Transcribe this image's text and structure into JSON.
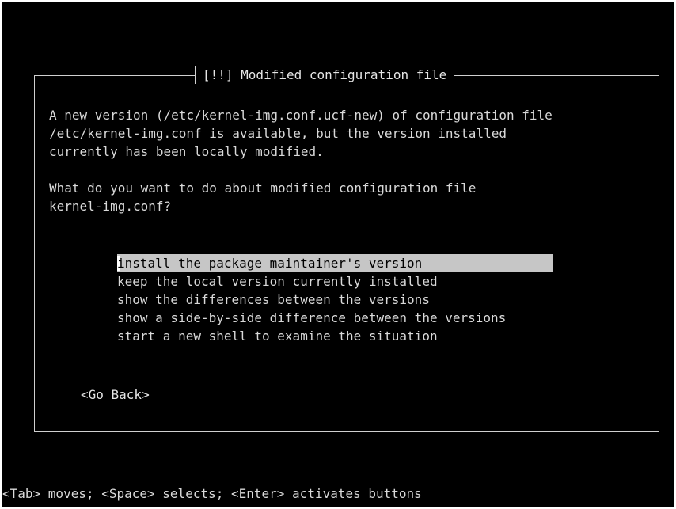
{
  "dialog": {
    "title": "[!!] Modified configuration file",
    "message_lines": [
      "A new version (/etc/kernel-img.conf.ucf-new) of configuration file",
      "/etc/kernel-img.conf is available, but the version installed",
      "currently has been locally modified."
    ],
    "question_lines": [
      "What do you want to do about modified configuration file",
      "kernel-img.conf?"
    ],
    "options": [
      "install the package maintainer's version",
      "keep the local version currently installed",
      "show the differences between the versions",
      "show a side-by-side difference between the versions",
      "start a new shell to examine the situation"
    ],
    "selected_option_index": 0,
    "back_button": "<Go Back>"
  },
  "status_bar": "<Tab> moves; <Space> selects; <Enter> activates buttons",
  "colors": {
    "background": "#000000",
    "foreground": "#d9d9d9",
    "selection_background": "#c6c6c6",
    "selection_foreground": "#000000"
  }
}
